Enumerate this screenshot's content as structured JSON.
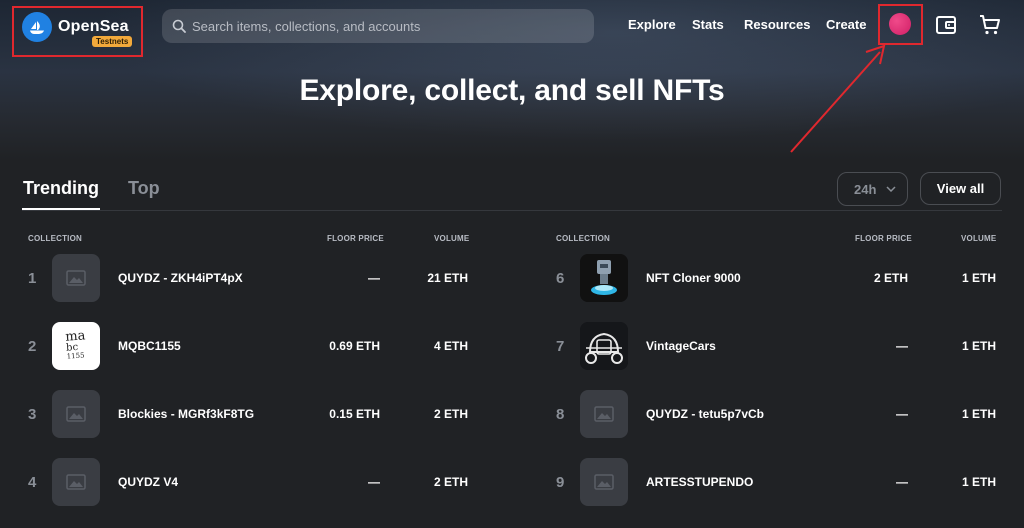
{
  "header": {
    "logo_name": "OpenSea",
    "logo_badge": "Testnets",
    "search_placeholder": "Search items, collections, and accounts",
    "nav": [
      "Explore",
      "Stats",
      "Resources",
      "Create"
    ]
  },
  "hero": {
    "title": "Explore, collect, and sell NFTs"
  },
  "tabs": {
    "trending": "Trending",
    "top": "Top"
  },
  "period": "24h",
  "view_all": "View all",
  "columns": {
    "collection": "COLLECTION",
    "floor": "FLOOR PRICE",
    "volume": "VOLUME"
  },
  "left_rows": [
    {
      "rank": "1",
      "name": "QUYDZ - ZKH4iPT4pX",
      "floor": "—",
      "volume": "21 ETH",
      "thumb": "placeholder"
    },
    {
      "rank": "2",
      "name": "MQBC1155",
      "floor": "0.69 ETH",
      "volume": "4 ETH",
      "thumb": "handwriting"
    },
    {
      "rank": "3",
      "name": "Blockies - MGRf3kF8TG",
      "floor": "0.15 ETH",
      "volume": "2 ETH",
      "thumb": "placeholder"
    },
    {
      "rank": "4",
      "name": "QUYDZ V4",
      "floor": "—",
      "volume": "2 ETH",
      "thumb": "placeholder"
    }
  ],
  "right_rows": [
    {
      "rank": "6",
      "name": "NFT Cloner 9000",
      "floor": "2 ETH",
      "volume": "1 ETH",
      "thumb": "robot"
    },
    {
      "rank": "7",
      "name": "VintageCars",
      "floor": "—",
      "volume": "1 ETH",
      "thumb": "car"
    },
    {
      "rank": "8",
      "name": "QUYDZ - tetu5p7vCb",
      "floor": "—",
      "volume": "1 ETH",
      "thumb": "placeholder"
    },
    {
      "rank": "9",
      "name": "ARTESSTUPENDO",
      "floor": "—",
      "volume": "1 ETH",
      "thumb": "placeholder"
    }
  ],
  "thumb_text": {
    "handwriting": [
      "ma",
      "bc",
      "1155"
    ]
  },
  "colors": {
    "accent": "#2081e2",
    "annotation": "#e0282e",
    "avatar": "#e0246e",
    "badge": "#f2a93b"
  },
  "icons": [
    "opensea-logo-icon",
    "search-icon",
    "wallet-icon",
    "cart-icon",
    "chevron-down-icon",
    "image-placeholder-icon"
  ]
}
